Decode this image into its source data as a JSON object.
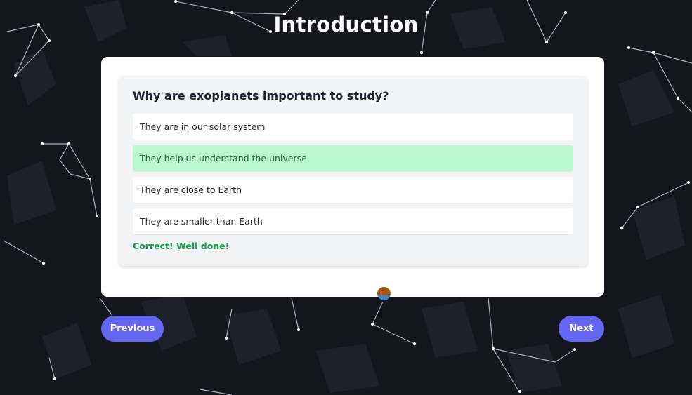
{
  "page": {
    "title": "Introduction"
  },
  "quiz": {
    "question": "Why are exoplanets important to study?",
    "options": [
      {
        "label": "They are in our solar system",
        "state": "default"
      },
      {
        "label": "They help us understand the universe",
        "state": "correct"
      },
      {
        "label": "They are close to Earth",
        "state": "default"
      },
      {
        "label": "They are smaller than Earth",
        "state": "default"
      }
    ],
    "feedback": "Correct! Well done!"
  },
  "navigation": {
    "previous_label": "Previous",
    "next_label": "Next"
  },
  "colors": {
    "background": "#15161d",
    "accent": "#6366f1",
    "correct_bg": "#bbf7d0",
    "correct_text": "#16a34a"
  }
}
